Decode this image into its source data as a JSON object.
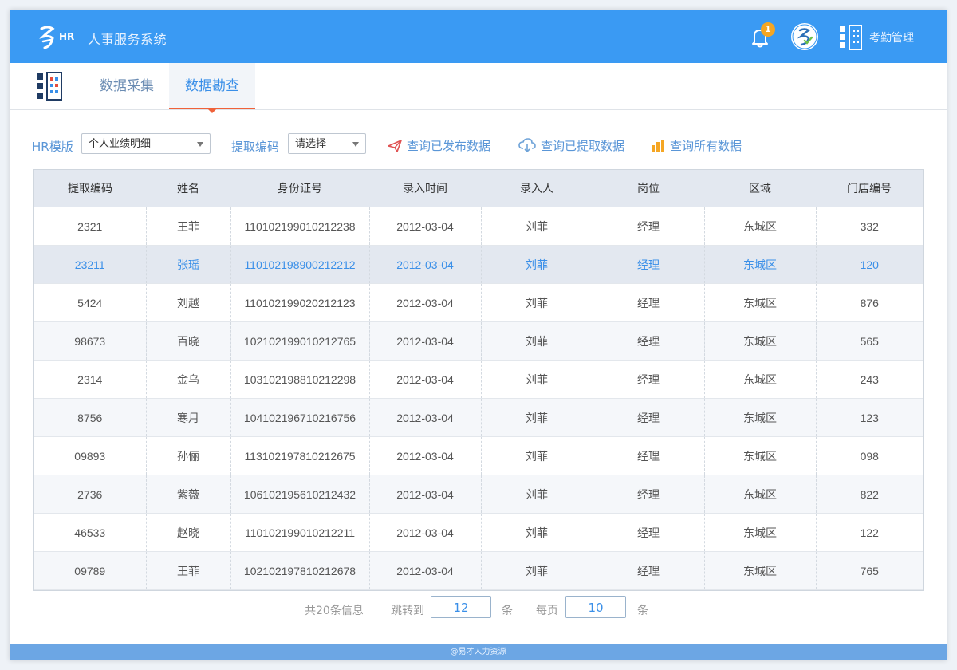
{
  "header": {
    "title": "人事服务系统",
    "notification_count": "1",
    "attendance_label": "考勤管理",
    "logo_text": "HR"
  },
  "tabs": [
    {
      "label": "数据采集"
    },
    {
      "label": "数据勘查"
    }
  ],
  "filters": {
    "template_label": "HR模版",
    "template_value": "个人业绩明细",
    "code_label": "提取编码",
    "code_value": "请选择",
    "actions": [
      {
        "label": "查询已发布数据",
        "icon": "send-icon"
      },
      {
        "label": "查询已提取数据",
        "icon": "cloud-download-icon"
      },
      {
        "label": "查询所有数据",
        "icon": "bar-chart-icon"
      }
    ]
  },
  "table": {
    "columns": [
      "提取编码",
      "姓名",
      "身份证号",
      "录入时间",
      "录入人",
      "岗位",
      "区域",
      "门店编号"
    ],
    "rows": [
      [
        "2321",
        "王菲",
        "110102199010212238",
        "2012-03-04",
        "刘菲",
        "经理",
        "东城区",
        "332"
      ],
      [
        "23211",
        "张瑶",
        "110102198900212212",
        "2012-03-04",
        "刘菲",
        "经理",
        "东城区",
        "120"
      ],
      [
        "5424",
        "刘越",
        "110102199020212123",
        "2012-03-04",
        "刘菲",
        "经理",
        "东城区",
        "876"
      ],
      [
        "98673",
        "百晓",
        "102102199010212765",
        "2012-03-04",
        "刘菲",
        "经理",
        "东城区",
        "565"
      ],
      [
        "2314",
        "金乌",
        "103102198810212298",
        "2012-03-04",
        "刘菲",
        "经理",
        "东城区",
        "243"
      ],
      [
        "8756",
        "寒月",
        "104102196710216756",
        "2012-03-04",
        "刘菲",
        "经理",
        "东城区",
        "123"
      ],
      [
        "09893",
        "孙俪",
        "113102197810212675",
        "2012-03-04",
        "刘菲",
        "经理",
        "东城区",
        "098"
      ],
      [
        "2736",
        "紫薇",
        "106102195610212432",
        "2012-03-04",
        "刘菲",
        "经理",
        "东城区",
        "822"
      ],
      [
        "46533",
        "赵晓",
        "110102199010212211",
        "2012-03-04",
        "刘菲",
        "经理",
        "东城区",
        "122"
      ],
      [
        "09789",
        "王菲",
        "102102197810212678",
        "2012-03-04",
        "刘菲",
        "经理",
        "东城区",
        "765"
      ]
    ]
  },
  "pager": {
    "total": "共20条信息",
    "jump_label": "跳转到",
    "jump_value": "12",
    "unit1": "条",
    "per_page_label": "每页",
    "per_page_value": "10",
    "unit2": "条"
  },
  "footer": {
    "text": "@易才人力资源"
  },
  "colors": {
    "header": "#3a9af3",
    "accent": "#3a8fe8",
    "tab_underline": "#f0623a",
    "footer": "#6ca6e4"
  }
}
